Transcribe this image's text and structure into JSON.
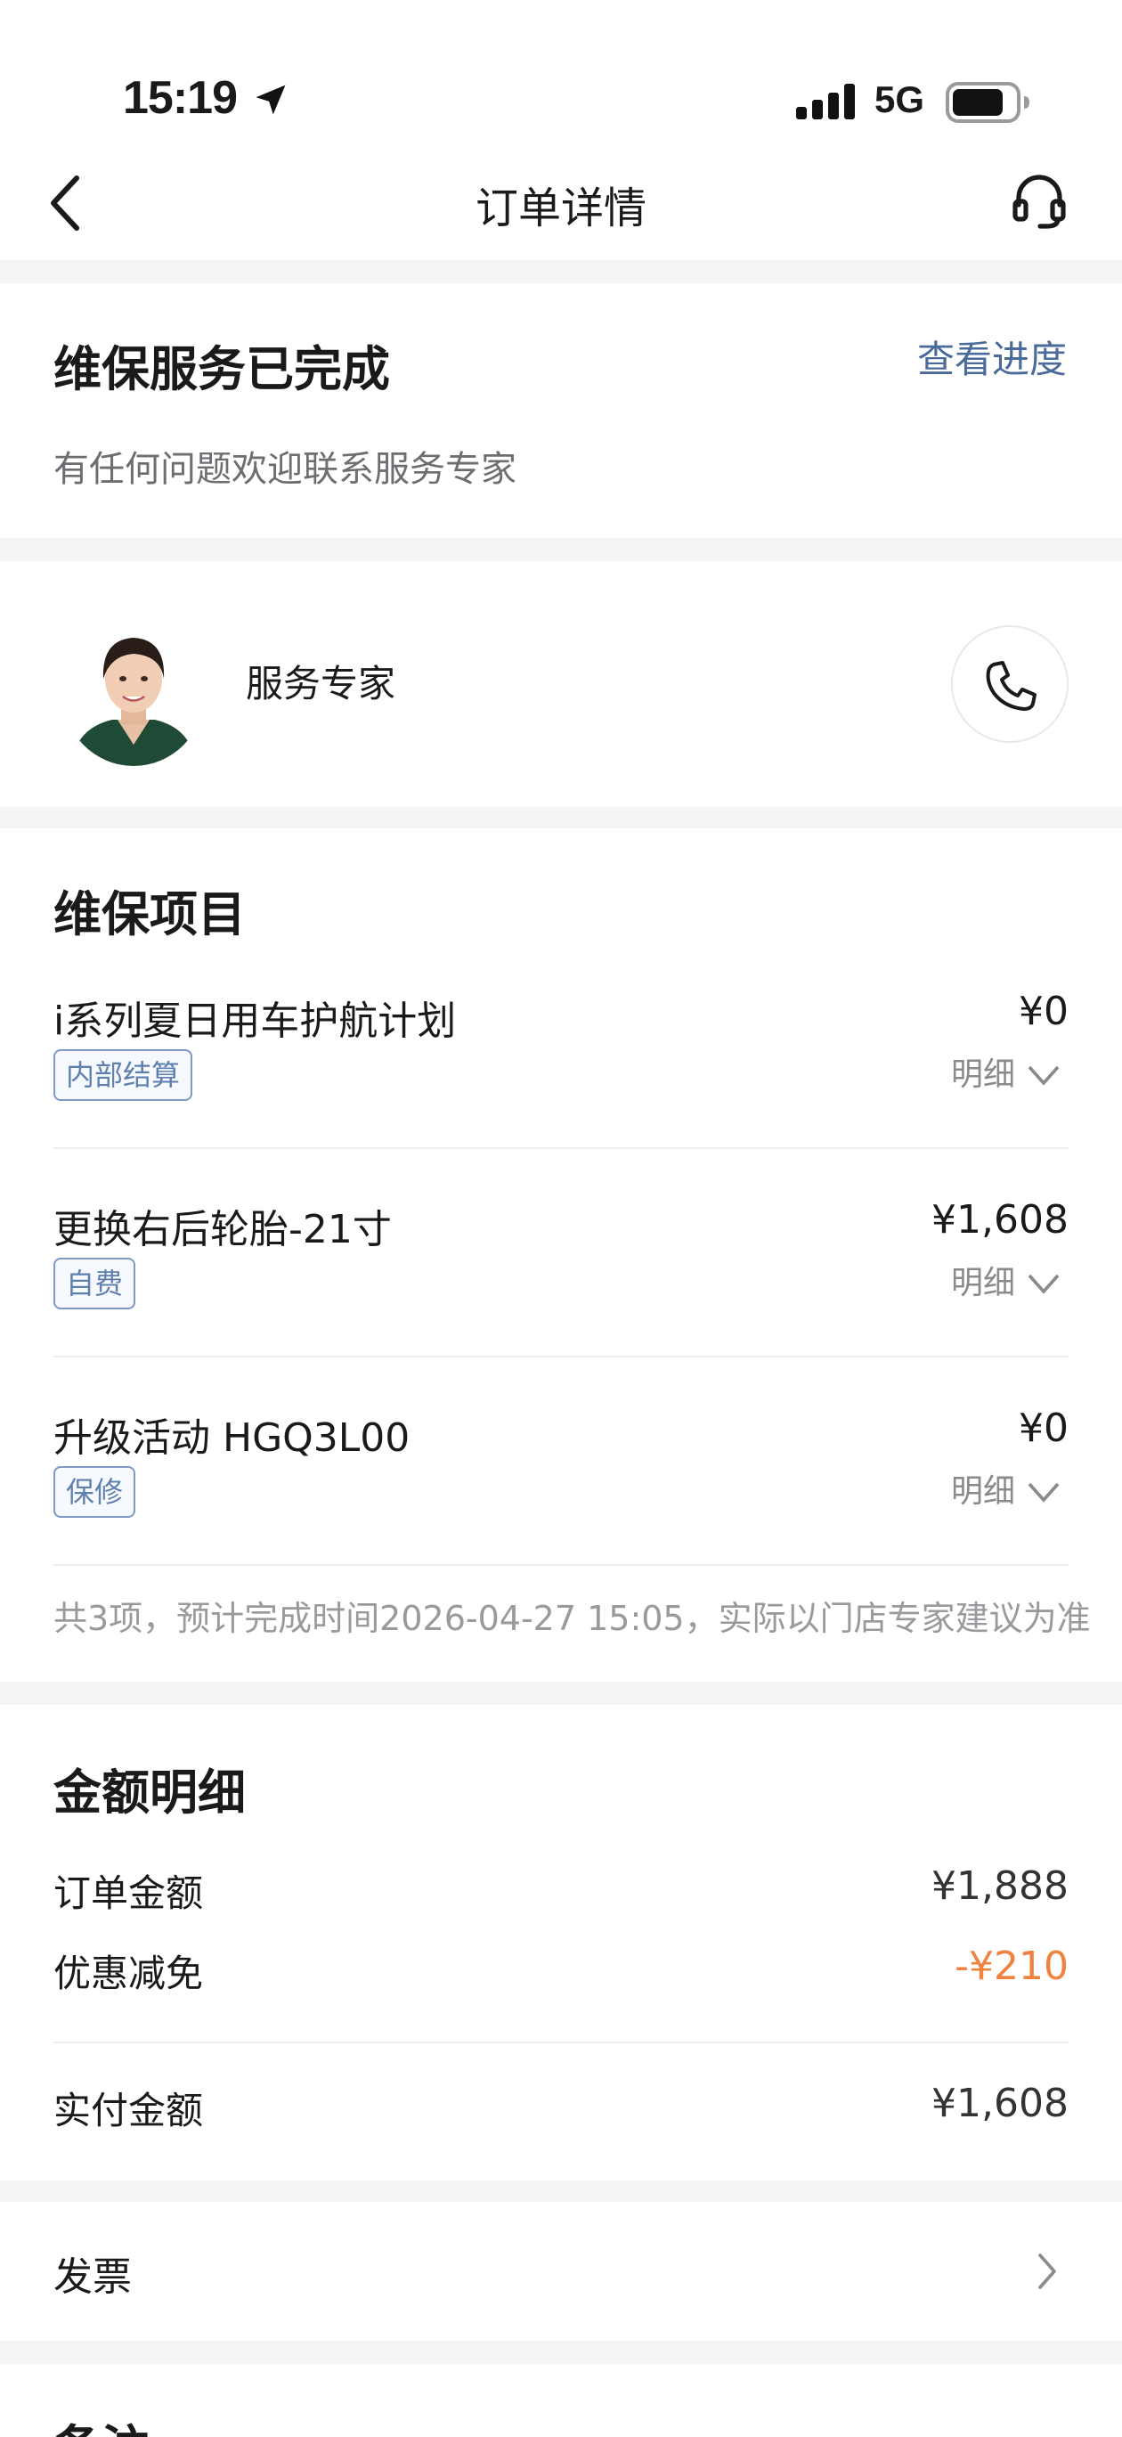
{
  "status_bar": {
    "time": "15:19",
    "network": "5G",
    "icons": [
      "location-arrow-icon",
      "signal-bars-icon",
      "battery-icon"
    ]
  },
  "nav": {
    "title": "订单详情",
    "back_icon": "chevron-left-icon",
    "support_icon": "headset-icon"
  },
  "order_status": {
    "title": "维保服务已完成",
    "progress_link": "查看进度",
    "subtitle": "有任何问题欢迎联系服务专家"
  },
  "advisor": {
    "label": "服务专家",
    "call_icon": "phone-icon"
  },
  "maintenance": {
    "title": "维保项目",
    "items": [
      {
        "name": "i系列夏日用车护航计划",
        "price": "¥0",
        "tag": "内部结算",
        "detail": "明细"
      },
      {
        "name": "更换右后轮胎-21寸",
        "price": "¥1,608",
        "tag": "自费",
        "detail": "明细"
      },
      {
        "name": "升级活动 HGQ3L00",
        "price": "¥0",
        "tag": "保修",
        "detail": "明细"
      }
    ],
    "footnote": "共3项，预计完成时间2026-04-27 15:05，实际以门店专家建议为准"
  },
  "amounts": {
    "title": "金额明细",
    "order_total": {
      "label": "订单金额",
      "value": "¥1,888"
    },
    "discount": {
      "label": "优惠减免",
      "value": "-¥210"
    },
    "paid": {
      "label": "实付金额",
      "value": "¥1,608"
    }
  },
  "invoice": {
    "label": "发票"
  },
  "remarks": {
    "title": "备注"
  },
  "colors": {
    "link": "#4a6b9a",
    "tag_border": "#7d9ac4",
    "discount": "#f0823e",
    "page_bg": "#f4f4f5"
  }
}
